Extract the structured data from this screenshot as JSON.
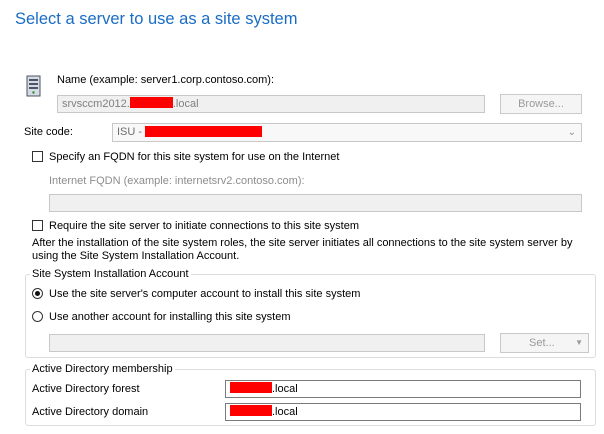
{
  "header": {
    "title": "Select a server to use as a site system"
  },
  "name_field": {
    "label": "Name (example: server1.corp.contoso.com):",
    "value_prefix": "srvsccm2012.",
    "value_suffix": ".local",
    "browse_label": "Browse..."
  },
  "site_code": {
    "label": "Site code:",
    "value_prefix": "ISU - "
  },
  "fqdn": {
    "checkbox_label": "Specify an FQDN for this site system for use on the Internet",
    "checked": false,
    "internet_fqdn_label": "Internet FQDN (example: internetsrv2.contoso.com):",
    "internet_fqdn_value": ""
  },
  "require_initiate": {
    "checkbox_label": "Require the site server to initiate connections to this site system",
    "checked": false,
    "description": "After the  installation of the site system roles, the site server initiates all connections to the site system server by using the Site System Installation Account."
  },
  "installation_account": {
    "group_label": "Site System Installation Account",
    "option_computer": "Use the site server's computer account to install this site system",
    "option_another": "Use another account for installing this site system",
    "selected": "computer",
    "account_value": "",
    "set_label": "Set..."
  },
  "active_directory": {
    "group_label": "Active Directory membership",
    "forest_label": "Active Directory forest",
    "forest_suffix": ".local",
    "domain_label": "Active Directory domain",
    "domain_suffix": ".local"
  },
  "colors": {
    "title": "#1a6cc4",
    "redaction": "#ff0000"
  }
}
